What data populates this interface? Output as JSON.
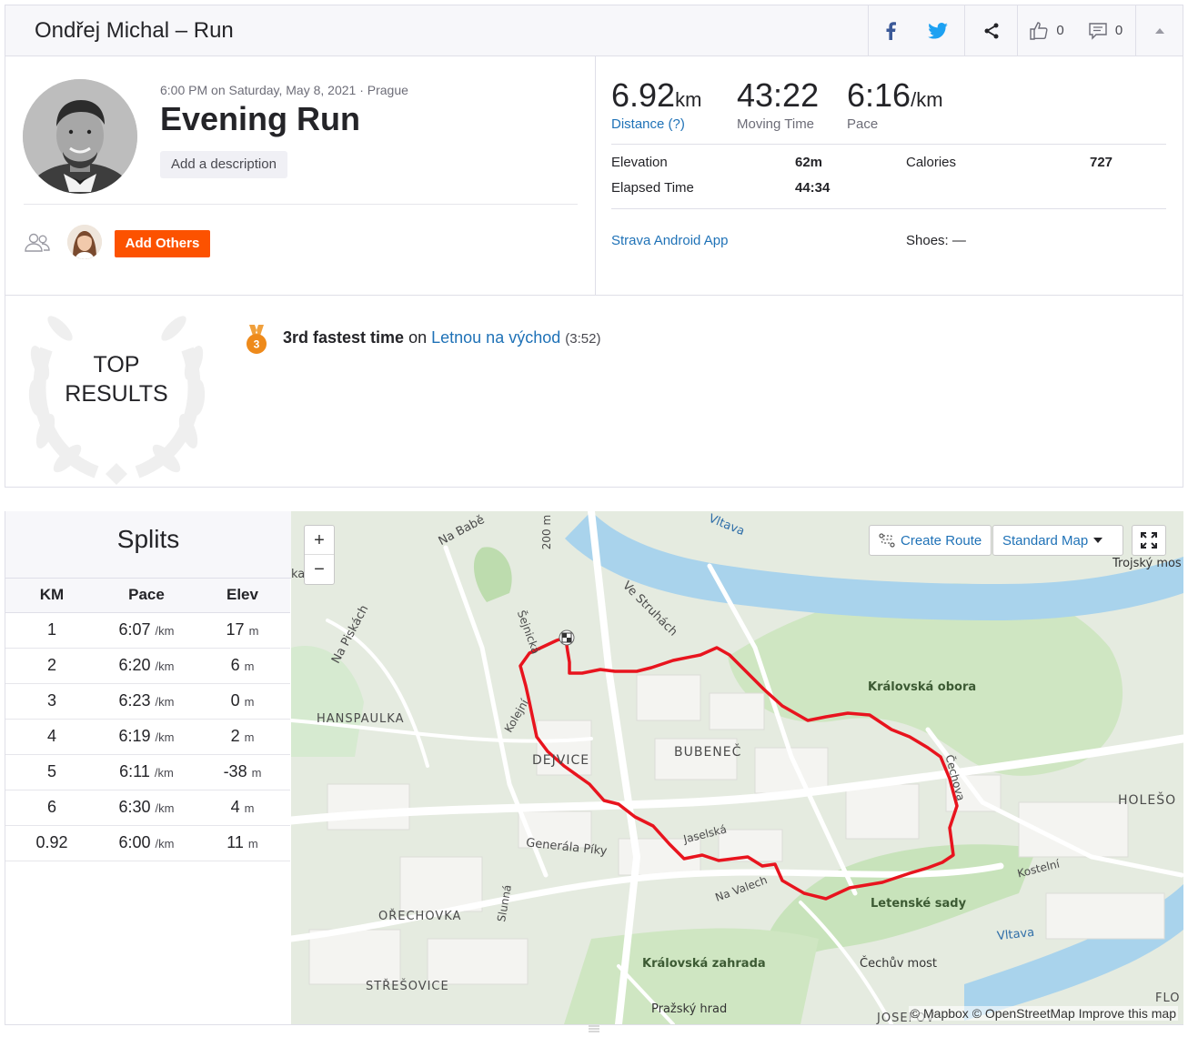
{
  "header": {
    "title": "Ondřej Michal – Run",
    "kudos_count": "0",
    "comments_count": "0"
  },
  "activity": {
    "date_location": "6:00 PM on Saturday, May 8, 2021 · Prague",
    "name": "Evening Run",
    "add_description": "Add a description",
    "add_others": "Add Others"
  },
  "stats": {
    "distance": {
      "value": "6.92",
      "unit": "km",
      "label": "Distance (?)"
    },
    "moving_time": {
      "value": "43:22",
      "label": "Moving Time"
    },
    "pace": {
      "value": "6:16",
      "unit": "/km",
      "label": "Pace"
    },
    "elevation": {
      "label": "Elevation",
      "value": "62m"
    },
    "calories": {
      "label": "Calories",
      "value": "727"
    },
    "elapsed_time": {
      "label": "Elapsed Time",
      "value": "44:34"
    },
    "device": "Strava Android App",
    "shoes": "Shoes: —"
  },
  "results": {
    "title_line1": "TOP",
    "title_line2": "RESULTS",
    "medal_rank": "3",
    "achievement": "3rd fastest time",
    "on": "on",
    "segment": "Letnou na východ",
    "segment_time": "(3:52)"
  },
  "splits": {
    "title": "Splits",
    "columns": [
      "KM",
      "Pace",
      "Elev"
    ],
    "pace_unit": "/km",
    "elev_unit": "m",
    "rows": [
      {
        "km": "1",
        "pace": "6:07",
        "elev": "17"
      },
      {
        "km": "2",
        "pace": "6:20",
        "elev": "6"
      },
      {
        "km": "3",
        "pace": "6:23",
        "elev": "0"
      },
      {
        "km": "4",
        "pace": "6:19",
        "elev": "2"
      },
      {
        "km": "5",
        "pace": "6:11",
        "elev": "-38"
      },
      {
        "km": "6",
        "pace": "6:30",
        "elev": "4"
      },
      {
        "km": "0.92",
        "pace": "6:00",
        "elev": "11"
      }
    ]
  },
  "map": {
    "zoom_in": "+",
    "zoom_out": "−",
    "create_route": "Create Route",
    "map_type": "Standard Map",
    "attribution": "© Mapbox © OpenStreetMap Improve this map",
    "route_color": "#e8141e",
    "labels": {
      "na_babe": "Na Babě",
      "vltava_top": "Vltava",
      "trojsky": "Trojský mos",
      "ve_struhach": "Ve Struhách",
      "na_piskach": "Na Piskách",
      "hanspaulka": "HANSPAULKA",
      "sejnicka": "Šejnická",
      "kolejni": "Kolejní",
      "dejvice": "DEJVICE",
      "bubenec": "BUBENEČ",
      "kralovska_obora": "Královská obora",
      "holesovice": "HOLEŠO",
      "generala_piky": "Generála Píky",
      "jaselska": "Jaselská",
      "na_valech": "Na Valech",
      "kostelni": "Kostelní",
      "letenske_sady": "Letenské sady",
      "orechovka": "OŘECHOVKA",
      "slunna": "Slunná",
      "vltava_bottom": "Vltava",
      "kralovska_zahrada": "Královská zahrada",
      "cechuv_most": "Čechův most",
      "stresovice": "STŘEŠOVICE",
      "prazsky_hrad": "Pražský hrad",
      "cechova": "Čechova",
      "km200": "200 m",
      "ka": "ka",
      "josefov": "JOSEFOV",
      "flo": "FLO"
    }
  }
}
